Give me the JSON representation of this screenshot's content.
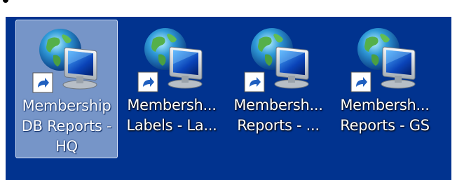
{
  "desktop": {
    "icons": [
      {
        "line1": "Membership",
        "line2": "DB Reports -",
        "line3": "HQ",
        "selected": true,
        "icon": "globe-monitor-icon"
      },
      {
        "line1": "Membersh...",
        "line2": "Labels - La...",
        "line3": "",
        "selected": false,
        "icon": "globe-monitor-icon"
      },
      {
        "line1": "Membersh...",
        "line2": "Reports - ...",
        "line3": "",
        "selected": false,
        "icon": "globe-monitor-icon"
      },
      {
        "line1": "Membersh...",
        "line2": "Reports - GS",
        "line3": "",
        "selected": false,
        "icon": "globe-monitor-icon"
      }
    ],
    "colors": {
      "background": "#01338f",
      "selection": "#bed2eb"
    }
  }
}
